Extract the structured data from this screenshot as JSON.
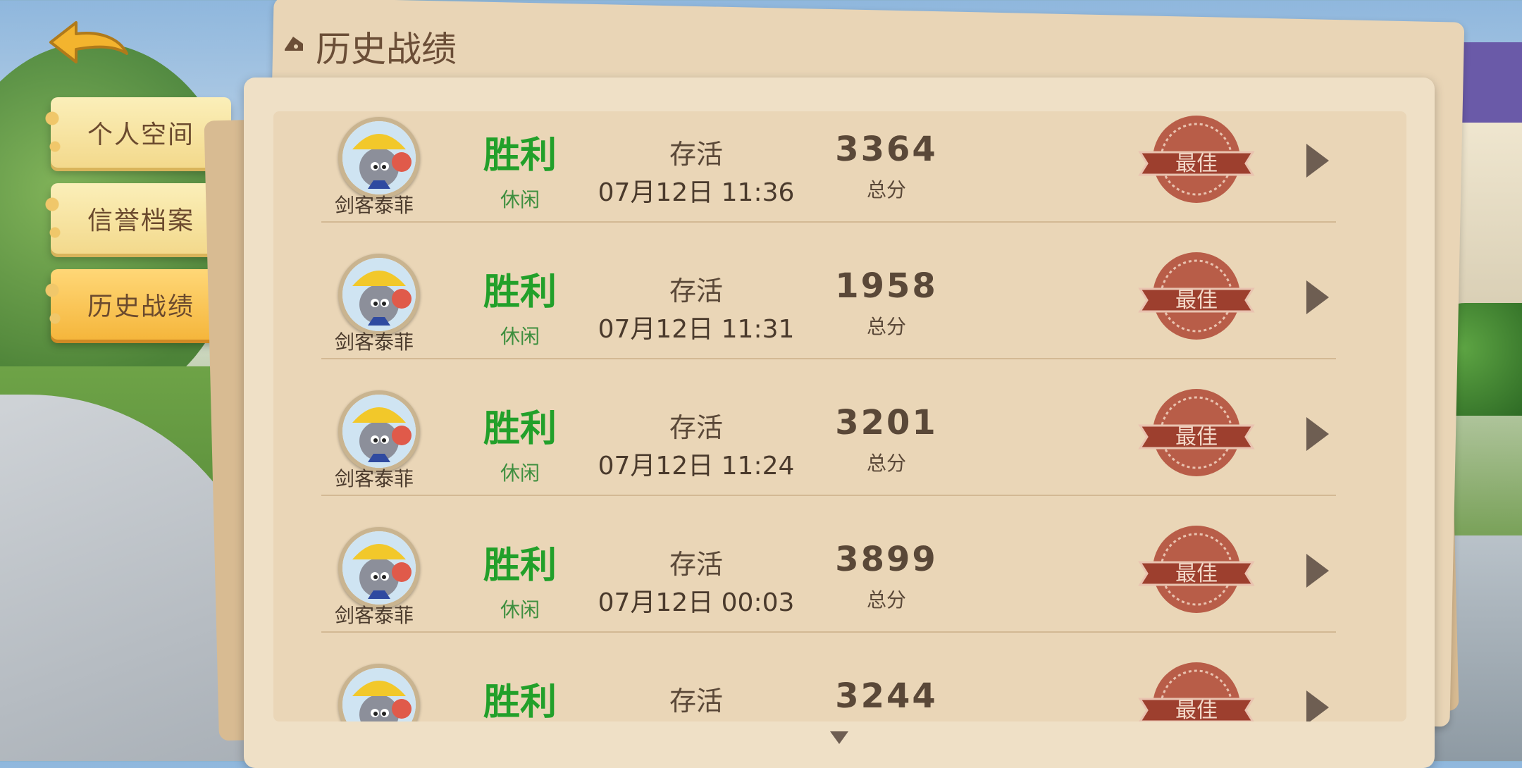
{
  "header": {
    "title": "历史战绩"
  },
  "sidebar": {
    "items": [
      {
        "label": "个人空间",
        "active": false
      },
      {
        "label": "信誉档案",
        "active": false
      },
      {
        "label": "历史战绩",
        "active": true
      }
    ]
  },
  "records": [
    {
      "character": "剑客泰菲",
      "result": "胜利",
      "mode": "休闲",
      "status": "存活",
      "time": "07月12日 11:36",
      "score": "3364",
      "score_label": "总分",
      "badge": "最佳"
    },
    {
      "character": "剑客泰菲",
      "result": "胜利",
      "mode": "休闲",
      "status": "存活",
      "time": "07月12日 11:31",
      "score": "1958",
      "score_label": "总分",
      "badge": "最佳"
    },
    {
      "character": "剑客泰菲",
      "result": "胜利",
      "mode": "休闲",
      "status": "存活",
      "time": "07月12日 11:24",
      "score": "3201",
      "score_label": "总分",
      "badge": "最佳"
    },
    {
      "character": "剑客泰菲",
      "result": "胜利",
      "mode": "休闲",
      "status": "存活",
      "time": "07月12日 00:03",
      "score": "3899",
      "score_label": "总分",
      "badge": "最佳"
    },
    {
      "character": "",
      "result": "胜利",
      "mode": "",
      "status": "存活",
      "time": "",
      "score": "3244",
      "score_label": "",
      "badge": "最佳"
    }
  ],
  "colors": {
    "win": "#22a02a",
    "badge": "#b3503c",
    "panel": "#efe0c6"
  }
}
